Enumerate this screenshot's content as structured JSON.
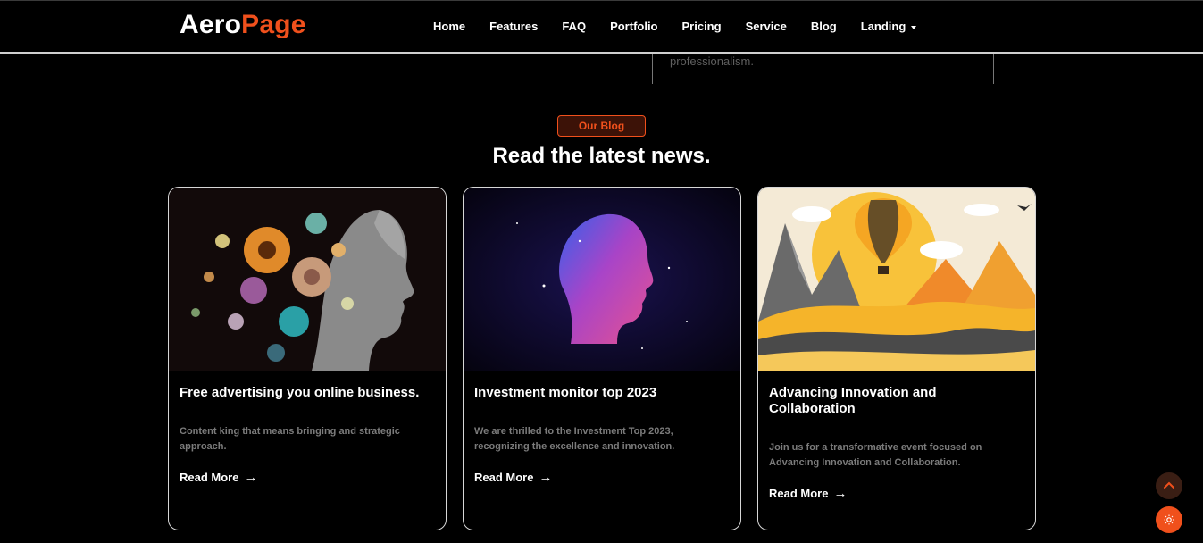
{
  "brand": {
    "part1": "Aero",
    "part2": "Page"
  },
  "nav": {
    "items": [
      "Home",
      "Features",
      "FAQ",
      "Portfolio",
      "Pricing",
      "Service",
      "Blog"
    ],
    "dropdown_label": "Landing"
  },
  "previous_section": {
    "text": "professionalism."
  },
  "blog": {
    "badge": "Our Blog",
    "heading": "Read the latest news.",
    "posts": [
      {
        "title": "Free advertising you online business.",
        "excerpt": "Content king that means bringing and strategic approach.",
        "cta": "Read More",
        "image_desc": "floral-portrait-illustration"
      },
      {
        "title": "Investment monitor top 2023",
        "excerpt": "We are thrilled to the Investment Top 2023, recognizing the excellence and innovation.",
        "cta": "Read More",
        "image_desc": "cosmic-head-silhouette"
      },
      {
        "title": "Advancing Innovation and Collaboration",
        "excerpt": "Join us for a transformative event focused on Advancing Innovation and Collaboration.",
        "cta": "Read More",
        "image_desc": "hot-air-balloon-landscape"
      }
    ]
  },
  "floating": {
    "scroll_top_icon": "chevron-up-icon",
    "theme_icon": "sun-icon"
  },
  "colors": {
    "accent": "#f0501c",
    "background": "#000000",
    "text": "#ffffff",
    "muted": "#7b7b7b"
  }
}
